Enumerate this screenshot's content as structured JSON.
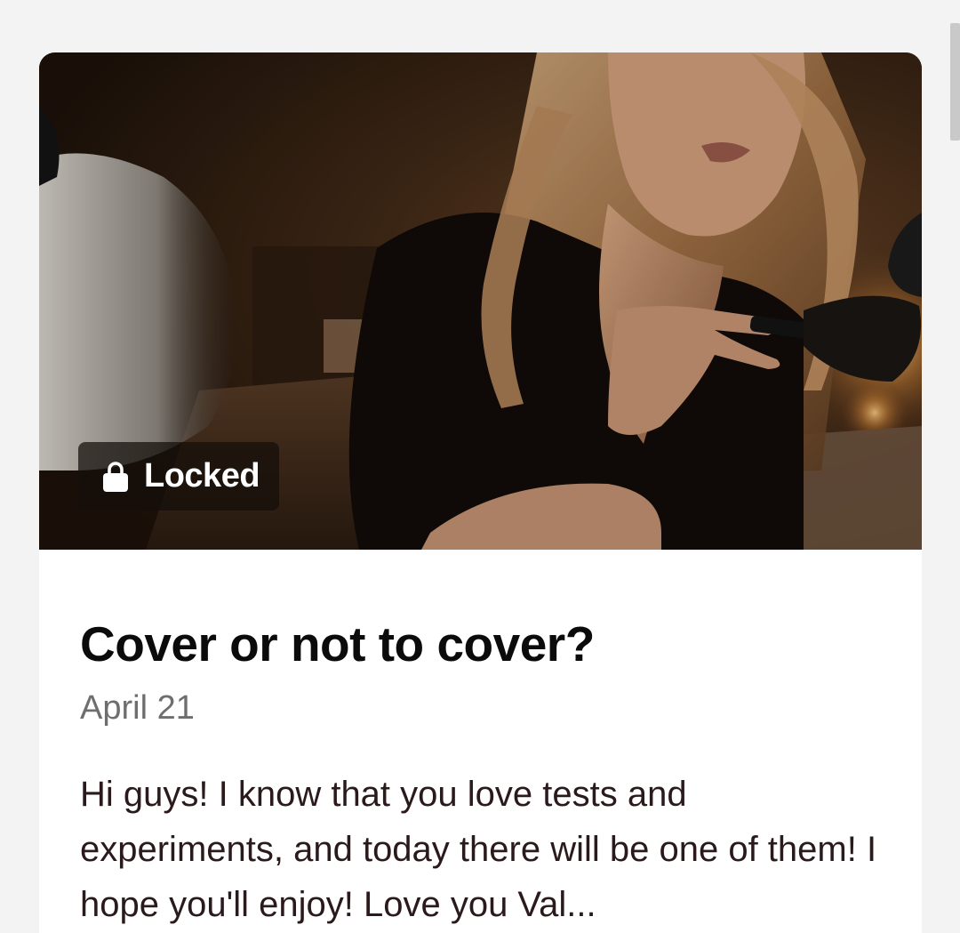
{
  "post": {
    "badge": {
      "icon": "lock-icon",
      "label": "Locked"
    },
    "title": "Cover or not to cover?",
    "date": "April 21",
    "excerpt": "Hi guys! I know that you love tests and experiments, and today there will be one of them! I hope you'll enjoy! Love you Val..."
  },
  "colors": {
    "page_background": "#f3f3f3",
    "card_background": "#ffffff",
    "title": "#0b0b0b",
    "date": "#6e6e6e",
    "excerpt": "#2b1a1c",
    "badge_background": "#140e0a"
  }
}
